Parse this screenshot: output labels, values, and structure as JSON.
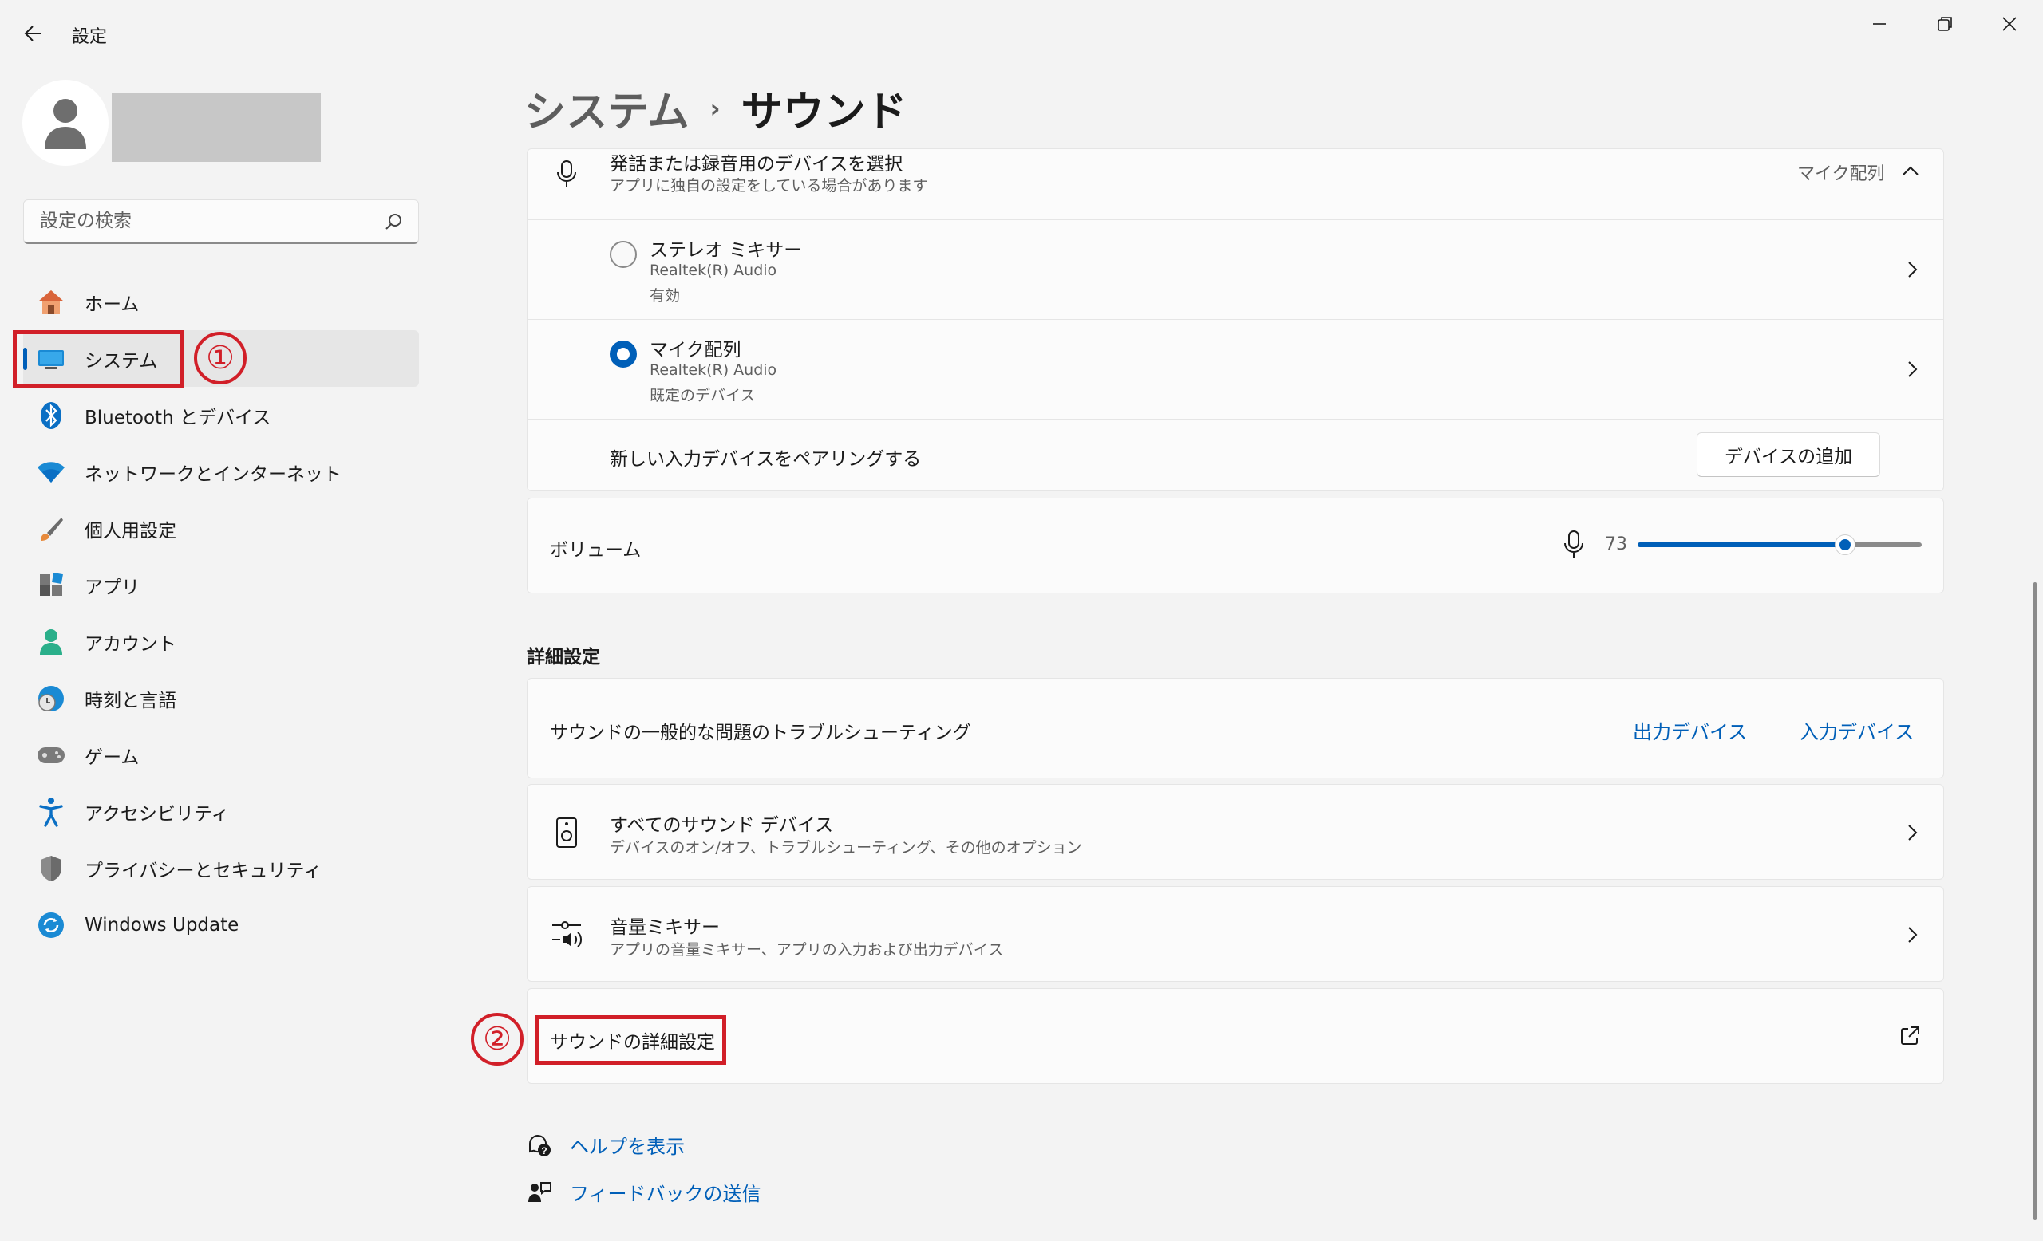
{
  "app": {
    "title": "設定",
    "window_controls": [
      "minimize-icon",
      "restore-icon",
      "close-icon"
    ]
  },
  "search": {
    "placeholder": "設定の検索"
  },
  "sidebar": {
    "items": [
      {
        "label": "ホーム",
        "icon": "home-icon"
      },
      {
        "label": "システム",
        "icon": "system-icon",
        "selected": true
      },
      {
        "label": "Bluetooth とデバイス",
        "icon": "bluetooth-icon"
      },
      {
        "label": "ネットワークとインターネット",
        "icon": "network-icon"
      },
      {
        "label": "個人用設定",
        "icon": "brush-icon"
      },
      {
        "label": "アプリ",
        "icon": "apps-icon"
      },
      {
        "label": "アカウント",
        "icon": "account-icon"
      },
      {
        "label": "時刻と言語",
        "icon": "time-language-icon"
      },
      {
        "label": "ゲーム",
        "icon": "gamepad-icon"
      },
      {
        "label": "アクセシビリティ",
        "icon": "accessibility-icon"
      },
      {
        "label": "プライバシーとセキュリティ",
        "icon": "shield-icon"
      },
      {
        "label": "Windows Update",
        "icon": "update-icon"
      }
    ]
  },
  "annotations": {
    "one": "①",
    "two": "②"
  },
  "breadcrumb": {
    "parent": "システム",
    "separator": "›",
    "current": "サウンド"
  },
  "input_select": {
    "title": "発話または録音用のデバイスを選択",
    "subtitle": "アプリに独自の設定をしている場合があります",
    "value": "マイク配列",
    "devices": [
      {
        "name": "ステレオ ミキサー",
        "driver": "Realtek(R) Audio",
        "status": "有効",
        "selected": false
      },
      {
        "name": "マイク配列",
        "driver": "Realtek(R) Audio",
        "status": "既定のデバイス",
        "selected": true
      }
    ],
    "pair_label": "新しい入力デバイスをペアリングする",
    "add_button": "デバイスの追加"
  },
  "volume": {
    "label": "ボリューム",
    "value": "73",
    "level": 0.73
  },
  "advanced": {
    "heading": "詳細設定",
    "troubleshoot": {
      "label": "サウンドの一般的な問題のトラブルシューティング",
      "output_link": "出力デバイス",
      "input_link": "入力デバイス"
    },
    "all_devices": {
      "title": "すべてのサウンド デバイス",
      "subtitle": "デバイスのオン/オフ、トラブルシューティング、その他のオプション"
    },
    "mixer": {
      "title": "音量ミキサー",
      "subtitle": "アプリの音量ミキサー、アプリの入力および出力デバイス"
    },
    "more_sound": {
      "title": "サウンドの詳細設定"
    }
  },
  "footer": {
    "help": "ヘルプを表示",
    "feedback": "フィードバックの送信"
  },
  "colors": {
    "accent": "#005fb8",
    "annotation": "#d11f28",
    "background": "#f3f3f3",
    "card": "#fbfbfb"
  }
}
